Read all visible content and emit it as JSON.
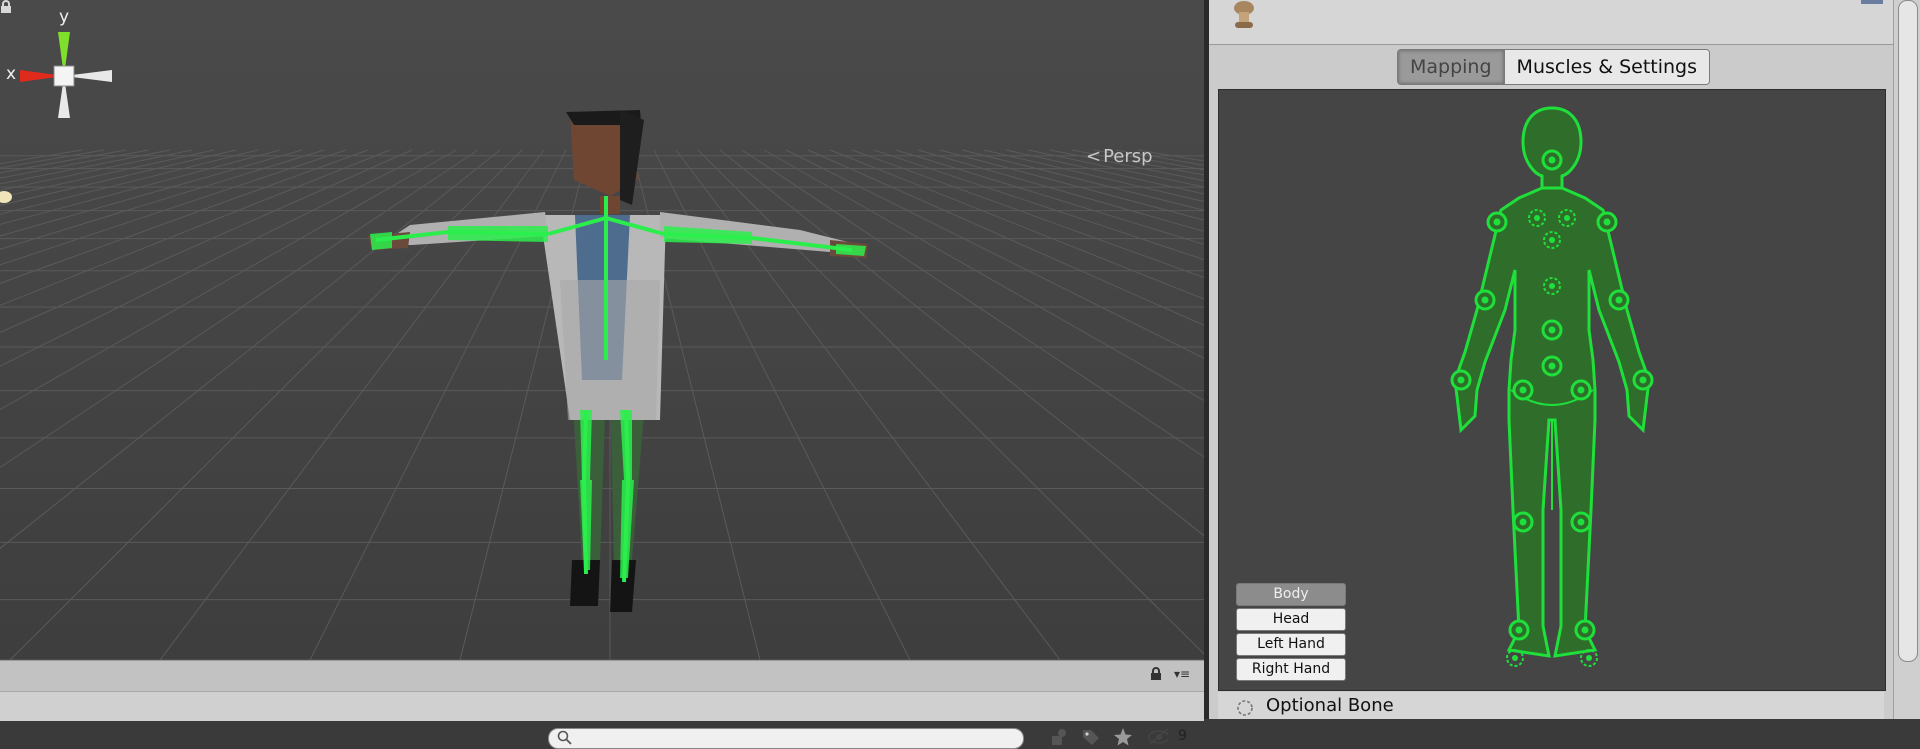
{
  "scene": {
    "gizmo": {
      "x_label": "x",
      "y_label": "y"
    },
    "projection_label": "Persp",
    "icons": {
      "lock": "lock-icon",
      "projection_arrow": "chevron-left-icon"
    }
  },
  "bottom_bar": {
    "search_placeholder": "",
    "hidden_count": "9",
    "icons": [
      "search-icon",
      "filter-by-type-icon",
      "filter-by-label-icon",
      "favorites-star-icon",
      "visibility-toggle-icon",
      "lock-icon",
      "panel-menu-icon"
    ]
  },
  "inspector": {
    "tabs": [
      {
        "label": "Mapping",
        "active": true
      },
      {
        "label": "Muscles & Settings",
        "active": false
      }
    ],
    "body_parts": [
      {
        "label": "Body",
        "selected": true
      },
      {
        "label": "Head",
        "selected": false
      },
      {
        "label": "Left Hand",
        "selected": false
      },
      {
        "label": "Right Hand",
        "selected": false
      }
    ],
    "legend_label": "Optional Bone",
    "colors": {
      "bone_ok": "#1fe03a",
      "figure_fill": "#2e6e2a",
      "panel_bg": "#454545"
    }
  }
}
